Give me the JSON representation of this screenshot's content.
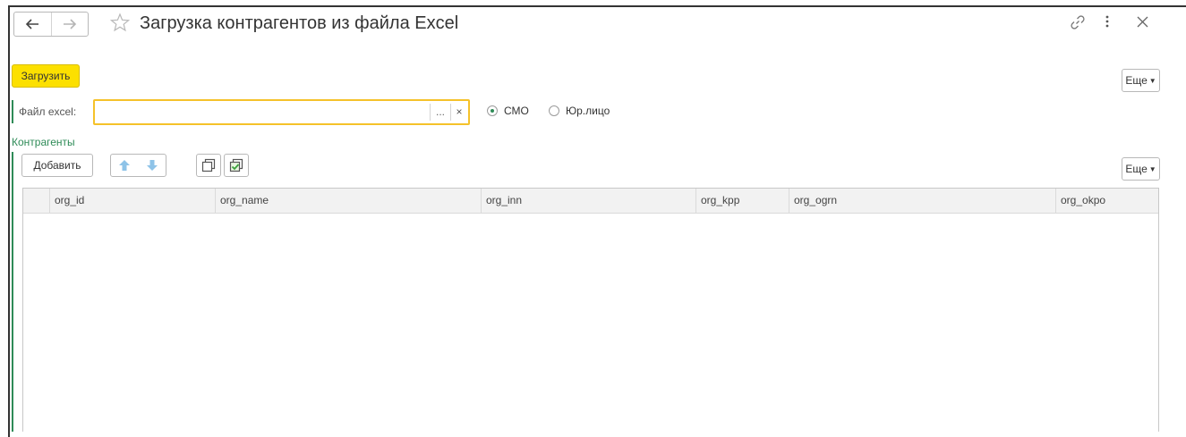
{
  "window": {
    "title": "Загрузка контрагентов из файла Excel"
  },
  "toolbar": {
    "load_label": "Загрузить",
    "more_label": "Еще"
  },
  "file_row": {
    "label": "Файл excel:",
    "value": "",
    "choose_label": "...",
    "clear_label": "×"
  },
  "radio": {
    "options": [
      {
        "label": "СМО",
        "checked": true
      },
      {
        "label": "Юр.лицо",
        "checked": false
      }
    ]
  },
  "counterparties": {
    "title": "Контрагенты",
    "add_label": "Добавить",
    "more_label": "Еще",
    "columns": [
      "org_id",
      "org_name",
      "org_inn",
      "org_kpp",
      "org_ogrn",
      "org_okpo"
    ],
    "rows": []
  },
  "colors": {
    "accent_green": "#2e8b57",
    "primary_button": "#fce000",
    "focus_border": "#f5c22a"
  }
}
